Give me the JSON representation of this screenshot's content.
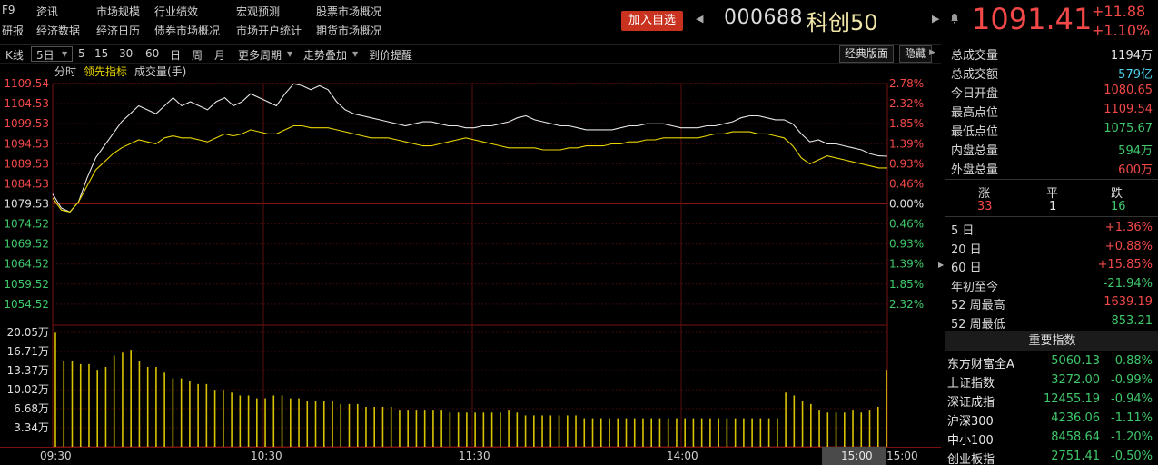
{
  "nav": {
    "row1": [
      "F9",
      "资讯",
      "市场规模",
      "行业绩效",
      "宏观预测",
      "股票市场概况"
    ],
    "row2": [
      "研报",
      "经济数据",
      "经济日历",
      "债券市场概况",
      "市场开户统计",
      "期货市场概况"
    ]
  },
  "header": {
    "add_fav": "加入自选",
    "code": "000688",
    "name": "科创50",
    "price": "1091.41",
    "change": "+11.88",
    "change_pct": "+1.10%"
  },
  "toolbar": {
    "items": [
      "K线",
      "5日",
      "5",
      "15",
      "30",
      "60",
      "日",
      "周",
      "月",
      "更多周期",
      "走势叠加",
      "到价提醒"
    ],
    "classic": "经典版面",
    "hide": "隐藏"
  },
  "subtabs": [
    "分时",
    "领先指标",
    "成交量(手)"
  ],
  "chart_data": {
    "type": "line",
    "price_axis": {
      "left_ticks": [
        "1109.54",
        "1104.53",
        "1099.53",
        "1094.53",
        "1089.53",
        "1084.53",
        "1079.53",
        "1074.52",
        "1069.52",
        "1064.52",
        "1059.52",
        "1054.52"
      ],
      "right_ticks": [
        "2.78%",
        "2.32%",
        "1.85%",
        "1.39%",
        "0.93%",
        "0.46%",
        "0.00%",
        "0.46%",
        "0.93%",
        "1.39%",
        "1.85%",
        "2.32%"
      ],
      "ylim": [
        1052,
        1109.54
      ],
      "prev_close": 1079.53
    },
    "volume_axis": {
      "ticks": [
        "20.05万",
        "16.71万",
        "13.37万",
        "10.02万",
        "6.68万",
        "3.34万"
      ],
      "ylim": [
        0,
        20.05
      ]
    },
    "time_ticks": [
      "09:30",
      "10:30",
      "11:30",
      "14:00",
      "15:00"
    ],
    "series": [
      {
        "color": "#e6e6e6",
        "values": [
          1082,
          1078.5,
          1077.5,
          1080,
          1086,
          1091,
          1094,
          1097,
          1100,
          1102,
          1104,
          1103,
          1102,
          1104,
          1106,
          1104,
          1105,
          1104,
          1103,
          1105,
          1106,
          1104,
          1105,
          1107,
          1106,
          1105,
          1104,
          1107,
          1109.5,
          1109,
          1108,
          1109,
          1108,
          1105,
          1103,
          1102,
          1101.5,
          1101,
          1100.5,
          1100,
          1099.5,
          1099,
          1099.5,
          1100,
          1100,
          1099.5,
          1099,
          1099,
          1098.5,
          1098.5,
          1099,
          1099,
          1099.5,
          1100,
          1101,
          1101.5,
          1100.5,
          1100,
          1099.5,
          1099,
          1099,
          1098.5,
          1098,
          1098,
          1098,
          1098,
          1098.5,
          1099,
          1099,
          1099.5,
          1099.5,
          1099.5,
          1099,
          1098.5,
          1098.5,
          1098.5,
          1099,
          1099,
          1099.5,
          1100,
          1101,
          1101.5,
          1101.5,
          1101,
          1100.5,
          1100.5,
          1099.5,
          1097,
          1095,
          1095.5,
          1094.5,
          1094.5,
          1094,
          1093.5,
          1093,
          1092,
          1091.5,
          1091.41
        ],
        "name": ""
      },
      {
        "color": "#e8d400",
        "values": [
          1081,
          1078,
          1077.5,
          1080,
          1084,
          1088,
          1090,
          1092,
          1093.5,
          1094.5,
          1095.5,
          1095,
          1094.5,
          1096,
          1096.5,
          1096,
          1096,
          1095.5,
          1095,
          1096,
          1097,
          1096.5,
          1097,
          1098,
          1097.5,
          1097,
          1097,
          1098,
          1099,
          1099,
          1098.5,
          1098.5,
          1098.5,
          1098,
          1097.5,
          1097,
          1096.5,
          1096,
          1096,
          1096,
          1095.5,
          1095,
          1094.5,
          1094,
          1094,
          1094.5,
          1095,
          1095.5,
          1096,
          1095.5,
          1095,
          1094.5,
          1094,
          1093.5,
          1093.5,
          1093.5,
          1093.5,
          1093,
          1093,
          1093,
          1093.5,
          1093.5,
          1094,
          1094,
          1094,
          1094.5,
          1094.5,
          1095,
          1095,
          1095.5,
          1095.5,
          1096,
          1096,
          1096,
          1096,
          1096,
          1096.5,
          1097,
          1097,
          1097.5,
          1097.5,
          1097.5,
          1097,
          1097,
          1096.5,
          1096,
          1094,
          1091,
          1089.5,
          1090.5,
          1091.5,
          1091,
          1090.5,
          1090,
          1089.5,
          1089,
          1088.5,
          1088.5
        ],
        "name": ""
      }
    ],
    "volume": [
      20,
      15,
      15,
      14.5,
      14.5,
      13.5,
      14,
      16,
      16.5,
      17,
      15,
      14,
      14,
      13,
      12,
      12,
      11.5,
      11,
      11,
      10,
      10,
      9.5,
      9,
      9,
      8.5,
      8.5,
      9,
      9,
      8.5,
      8.5,
      8,
      8,
      8,
      8,
      7.5,
      7.5,
      7.5,
      7,
      7,
      7,
      7,
      6.5,
      6.5,
      6.5,
      6.5,
      6.5,
      6.5,
      6,
      6,
      6,
      6,
      6,
      6,
      6,
      6.5,
      6,
      5.5,
      5.5,
      5.5,
      5.5,
      5.5,
      5.5,
      5.5,
      5,
      5,
      5,
      5,
      5,
      5,
      5,
      5,
      5,
      5,
      5,
      5,
      5,
      5,
      5,
      5,
      5,
      5,
      5,
      5,
      5,
      5,
      5,
      5,
      9.5,
      9,
      8,
      7.5,
      6.5,
      6,
      6,
      6,
      6.5,
      6,
      6.5,
      7,
      13.5
    ]
  },
  "cursor_time": "15:00",
  "stats": [
    {
      "label": "总成交量",
      "value": "1194万",
      "color": "white"
    },
    {
      "label": "总成交额",
      "value": "579亿",
      "color": "cyan"
    },
    {
      "label": "今日开盘",
      "value": "1080.65",
      "color": "red"
    },
    {
      "label": "最高点位",
      "value": "1109.54",
      "color": "red"
    },
    {
      "label": "最低点位",
      "value": "1075.67",
      "color": "green"
    },
    {
      "label": "内盘总量",
      "value": "594万",
      "color": "green"
    },
    {
      "label": "外盘总量",
      "value": "600万",
      "color": "red"
    }
  ],
  "updown": {
    "up_label": "涨",
    "flat_label": "平",
    "down_label": "跌",
    "up": "33",
    "flat": "1",
    "down": "16"
  },
  "periods": [
    {
      "label": "5 日",
      "value": "+1.36%",
      "color": "red"
    },
    {
      "label": "20 日",
      "value": "+0.88%",
      "color": "red"
    },
    {
      "label": "60 日",
      "value": "+15.85%",
      "color": "red"
    },
    {
      "label": "年初至今",
      "value": "-21.94%",
      "color": "green"
    },
    {
      "label": "52 周最高",
      "value": "1639.19",
      "color": "red"
    },
    {
      "label": "52 周最低",
      "value": "853.21",
      "color": "green"
    }
  ],
  "key_index_title": "重要指数",
  "key_indices": [
    {
      "name": "东方财富全A",
      "price": "5060.13",
      "pct": "-0.88%"
    },
    {
      "name": "上证指数",
      "price": "3272.00",
      "pct": "-0.99%"
    },
    {
      "name": "深证成指",
      "price": "12455.19",
      "pct": "-0.94%"
    },
    {
      "name": "沪深300",
      "price": "4236.06",
      "pct": "-1.11%"
    },
    {
      "name": "中小100",
      "price": "8458.64",
      "pct": "-1.20%"
    },
    {
      "name": "创业板指",
      "price": "2751.41",
      "pct": "-0.50%"
    }
  ]
}
